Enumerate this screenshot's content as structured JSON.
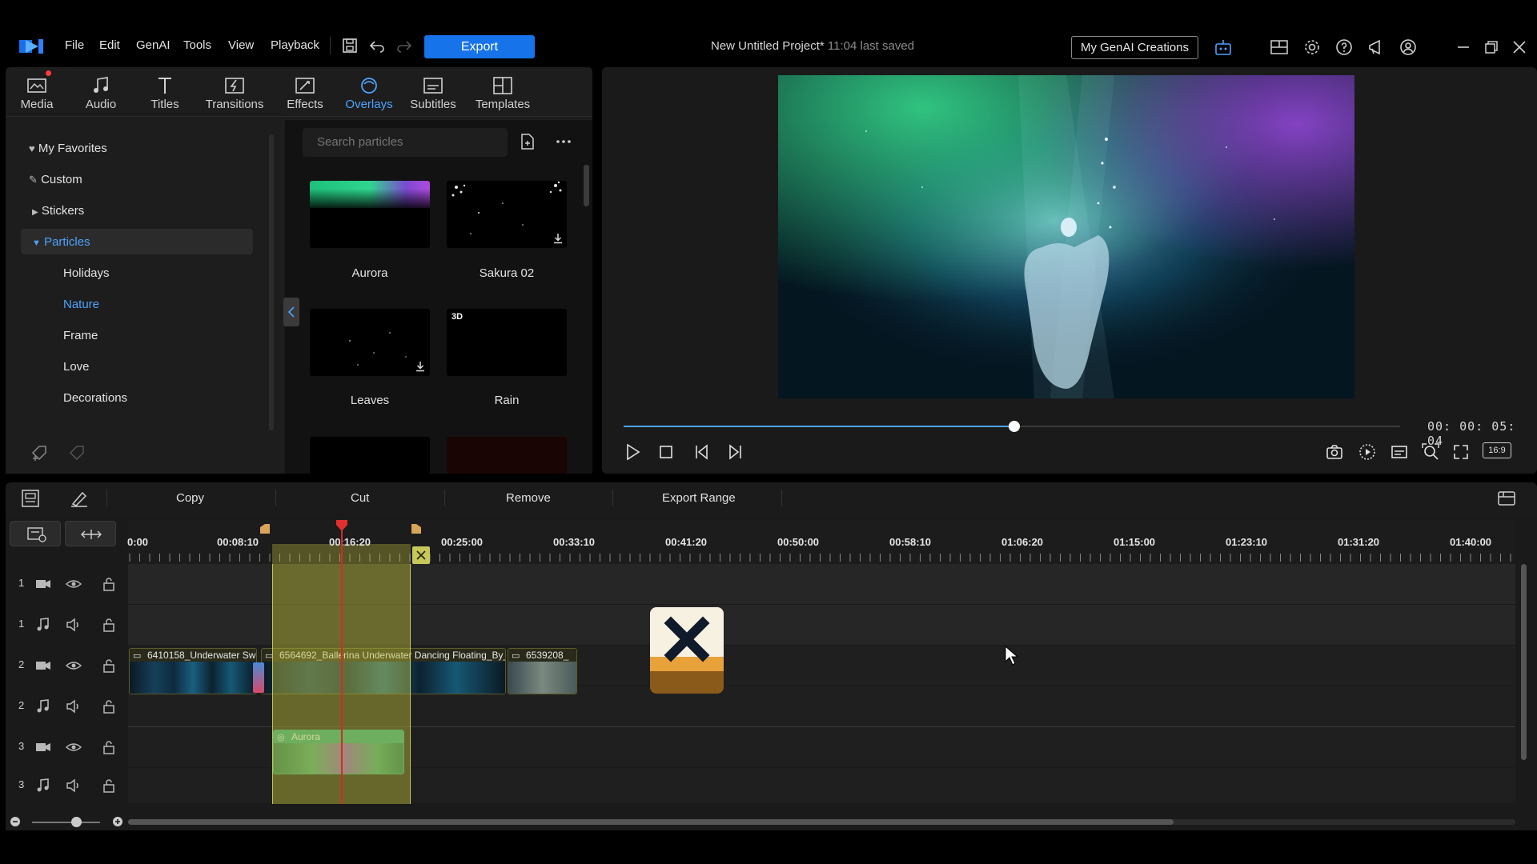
{
  "menubar": {
    "items": [
      "File",
      "Edit",
      "GenAI",
      "Tools",
      "View",
      "Playback"
    ],
    "export_label": "Export",
    "project_title": "New Untitled Project*",
    "last_saved": "11:04 last saved",
    "genai_button": "My GenAI Creations"
  },
  "library": {
    "tabs": [
      {
        "label": "Media",
        "icon": "media-icon"
      },
      {
        "label": "Audio",
        "icon": "music-note-icon"
      },
      {
        "label": "Titles",
        "icon": "text-icon"
      },
      {
        "label": "Transitions",
        "icon": "transition-icon"
      },
      {
        "label": "Effects",
        "icon": "effects-icon"
      },
      {
        "label": "Overlays",
        "icon": "overlay-icon"
      },
      {
        "label": "Subtitles",
        "icon": "subtitles-icon"
      },
      {
        "label": "Templates",
        "icon": "templates-icon"
      }
    ],
    "active_tab": "Overlays",
    "tree": {
      "favorites": "My Favorites",
      "custom": "Custom",
      "stickers": "Stickers",
      "particles": "Particles",
      "children": [
        "Holidays",
        "Nature",
        "Frame",
        "Love",
        "Decorations"
      ],
      "selected_child": "Nature"
    },
    "search_placeholder": "Search particles",
    "items": [
      {
        "label": "Aurora"
      },
      {
        "label": "Sakura 02"
      },
      {
        "label": "Leaves"
      },
      {
        "label": "Rain",
        "badge": "3D"
      }
    ]
  },
  "preview": {
    "timecode": "00: 00: 05: 04",
    "progress": 0.503,
    "aspect": "16:9"
  },
  "timeline_toolbar": {
    "copy": "Copy",
    "cut": "Cut",
    "remove": "Remove",
    "export_range": "Export Range"
  },
  "timeline": {
    "ruler": [
      "0:00",
      "00:08:10",
      "00:16:20",
      "00:25:00",
      "00:33:10",
      "00:41:20",
      "00:50:00",
      "00:58:10",
      "01:06:20",
      "01:15:00",
      "01:23:10",
      "01:31:20",
      "01:40:00"
    ],
    "tracks": [
      {
        "num": "1",
        "kind": "video"
      },
      {
        "num": "1",
        "kind": "audio"
      },
      {
        "num": "2",
        "kind": "video"
      },
      {
        "num": "2",
        "kind": "audio"
      },
      {
        "num": "3",
        "kind": "video"
      },
      {
        "num": "3",
        "kind": "audio"
      }
    ],
    "clips": {
      "c1": "6410158_Underwater Sw",
      "c2": "6564692_Ballerina Underwater Dancing Floating_By_",
      "c3": "6539208_",
      "overlay": "Aurora"
    }
  },
  "colors": {
    "accent": "#1673ea",
    "active_tab": "#4da3ff",
    "playhead": "#d42a2a",
    "range_selection": "#bebe3c",
    "overlay_clip": "#2aa37a"
  }
}
